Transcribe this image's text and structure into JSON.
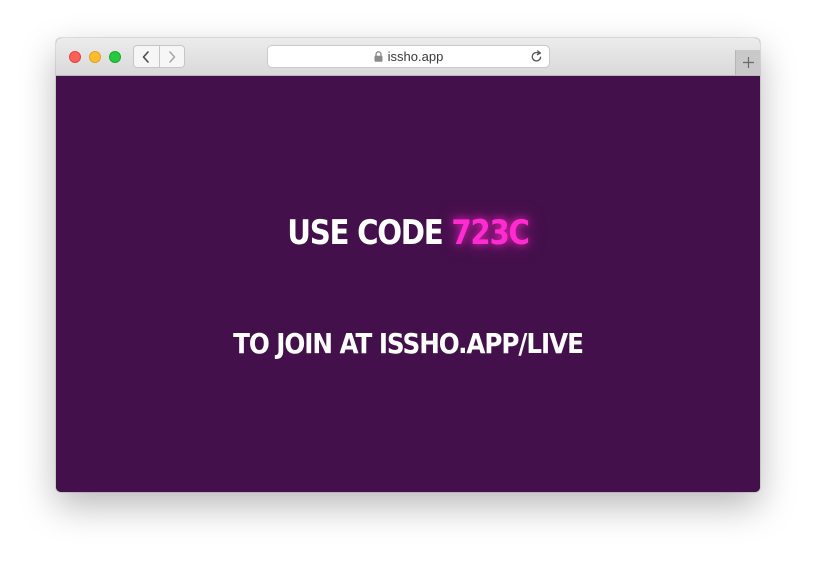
{
  "browser": {
    "url": "issho.app",
    "icons": {
      "close": "close-dot-icon",
      "minimize": "minimize-dot-icon",
      "maximize": "maximize-dot-icon",
      "back": "chevron-left-icon",
      "forward": "chevron-right-icon",
      "lock": "lock-icon",
      "reload": "reload-icon",
      "new_tab": "plus-icon"
    }
  },
  "page": {
    "line1_prefix": "USE CODE",
    "code": "723C",
    "line2": "TO JOIN AT ISSHO.APP/LIVE"
  },
  "colors": {
    "background": "#43104b",
    "text": "#ffffff",
    "code_accent": "#ff2bd0"
  }
}
